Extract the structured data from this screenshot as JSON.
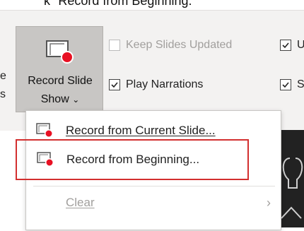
{
  "caption": {
    "text": "k \"Record from Beginning.\""
  },
  "ribbon": {
    "left_edge_lines": [
      "e",
      "s"
    ],
    "record_button": {
      "line1": "Record Slide",
      "line2": "Show",
      "icon": "record-slide-show-icon"
    },
    "checkboxes": [
      {
        "label": "Keep Slides Updated",
        "checked": false,
        "disabled": true
      },
      {
        "label": "Play Narrations",
        "checked": true,
        "disabled": false
      },
      {
        "label": "U",
        "checked": true,
        "disabled": false
      },
      {
        "label": "S",
        "checked": true,
        "disabled": false
      }
    ]
  },
  "menu": {
    "items": [
      {
        "label": "Record from Current Slide...",
        "icon": "record-slide-icon",
        "disabled": false
      },
      {
        "label": "Record from Beginning...",
        "icon": "record-slide-icon",
        "disabled": false,
        "highlighted": true
      },
      {
        "label": "Clear",
        "icon": "",
        "disabled": true,
        "submenu": true
      }
    ]
  },
  "colors": {
    "highlight_border": "#d32f2f",
    "record_dot": "#e81123"
  }
}
